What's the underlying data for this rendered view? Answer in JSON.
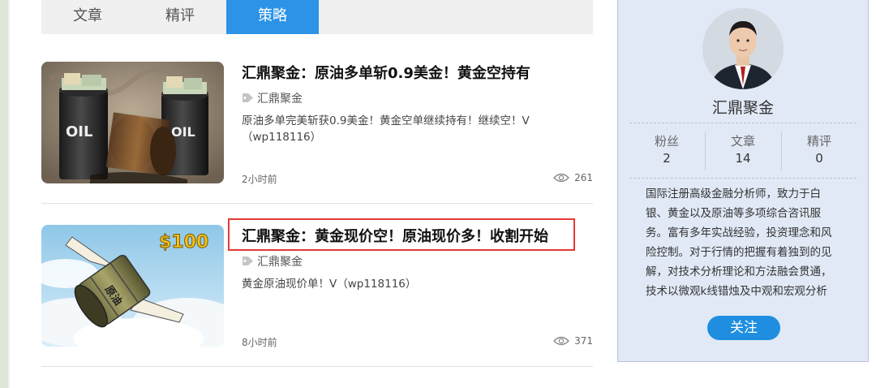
{
  "tabs": [
    {
      "label": "文章",
      "active": false
    },
    {
      "label": "精评",
      "active": false
    },
    {
      "label": "策略",
      "active": true
    }
  ],
  "articles": [
    {
      "title": "汇鼎聚金：原油多单斩0.9美金！黄金空持有",
      "author": "汇鼎聚金",
      "description": "原油多单完美斩获0.9美金！黄金空单继续持有！继续空！V（wp118116）",
      "time": "2小时前",
      "views": "261",
      "thumbnail": "oil-barrels-with-money",
      "thumbnail_text": "OIL",
      "highlighted": false
    },
    {
      "title": "汇鼎聚金：黄金现价空！原油现价多！收割开始",
      "author": "汇鼎聚金",
      "description": "黄金原油现价单！V（wp118116）",
      "time": "8小时前",
      "views": "371",
      "thumbnail": "flying-oil-barrel-with-wings",
      "thumbnail_text": "原油",
      "thumbnail_sign": "$100",
      "highlighted": true
    }
  ],
  "profile": {
    "name": "汇鼎聚金",
    "stats": [
      {
        "label": "粉丝",
        "value": "2"
      },
      {
        "label": "文章",
        "value": "14"
      },
      {
        "label": "精评",
        "value": "0"
      }
    ],
    "bio": "国际注册高级金融分析师，致力于白银、黄金以及原油等多项综合咨讯服务。富有多年实战经验，投资理念和风险控制。对于行情的把握有着独到的见解，对技术分析理论和方法融会贯通，技术以微观k线错烛及中观和宏观分析",
    "follow_label": "关注"
  },
  "colors": {
    "tab_active": "#2c93e6",
    "follow_button": "#1f8ee0",
    "highlight_border": "#e53935",
    "sidebar_bg": "#e1e9f6"
  }
}
